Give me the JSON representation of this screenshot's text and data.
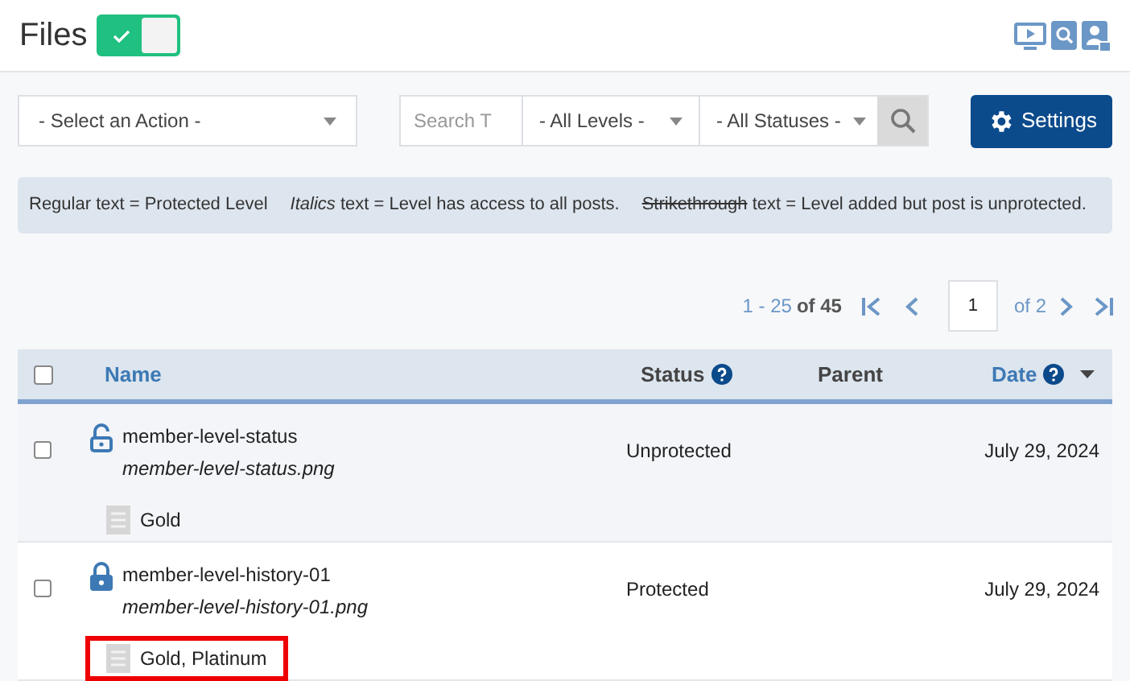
{
  "header": {
    "title": "Files",
    "toggle_on": true
  },
  "toolbar": {
    "action_select": "- Select an Action -",
    "search": {
      "placeholder": "Search T"
    },
    "levels_select": "- All Levels -",
    "statuses_select": "- All Statuses -",
    "settings_button": "Settings"
  },
  "legend": [
    {
      "kind": "regular",
      "text": "Regular text = Protected Level"
    },
    {
      "kind": "italic",
      "term": "Italics",
      "text": "text = Level has access to all posts."
    },
    {
      "kind": "strike",
      "term": "Strikethrough",
      "text": "text = Level added but post is unprotected."
    }
  ],
  "pagination": {
    "range": "1 - 25",
    "total": "of 45",
    "page": "1",
    "pages": "of 2"
  },
  "table": {
    "select_all_checked": false,
    "columns": [
      "Name",
      "Status",
      "Parent",
      "Date"
    ],
    "rows": [
      {
        "checked": false,
        "locked": false,
        "title": "member-level-status",
        "file": "member-level-status.png",
        "levels": "Gold",
        "highlighted": false,
        "status": "Unprotected",
        "date": "July 29, 2024"
      },
      {
        "checked": false,
        "locked": true,
        "title": "member-level-history-01",
        "file": "member-level-history-01.png",
        "levels": "Gold, Platinum",
        "highlighted": true,
        "status": "Protected",
        "date": "July 29, 2024"
      }
    ]
  }
}
